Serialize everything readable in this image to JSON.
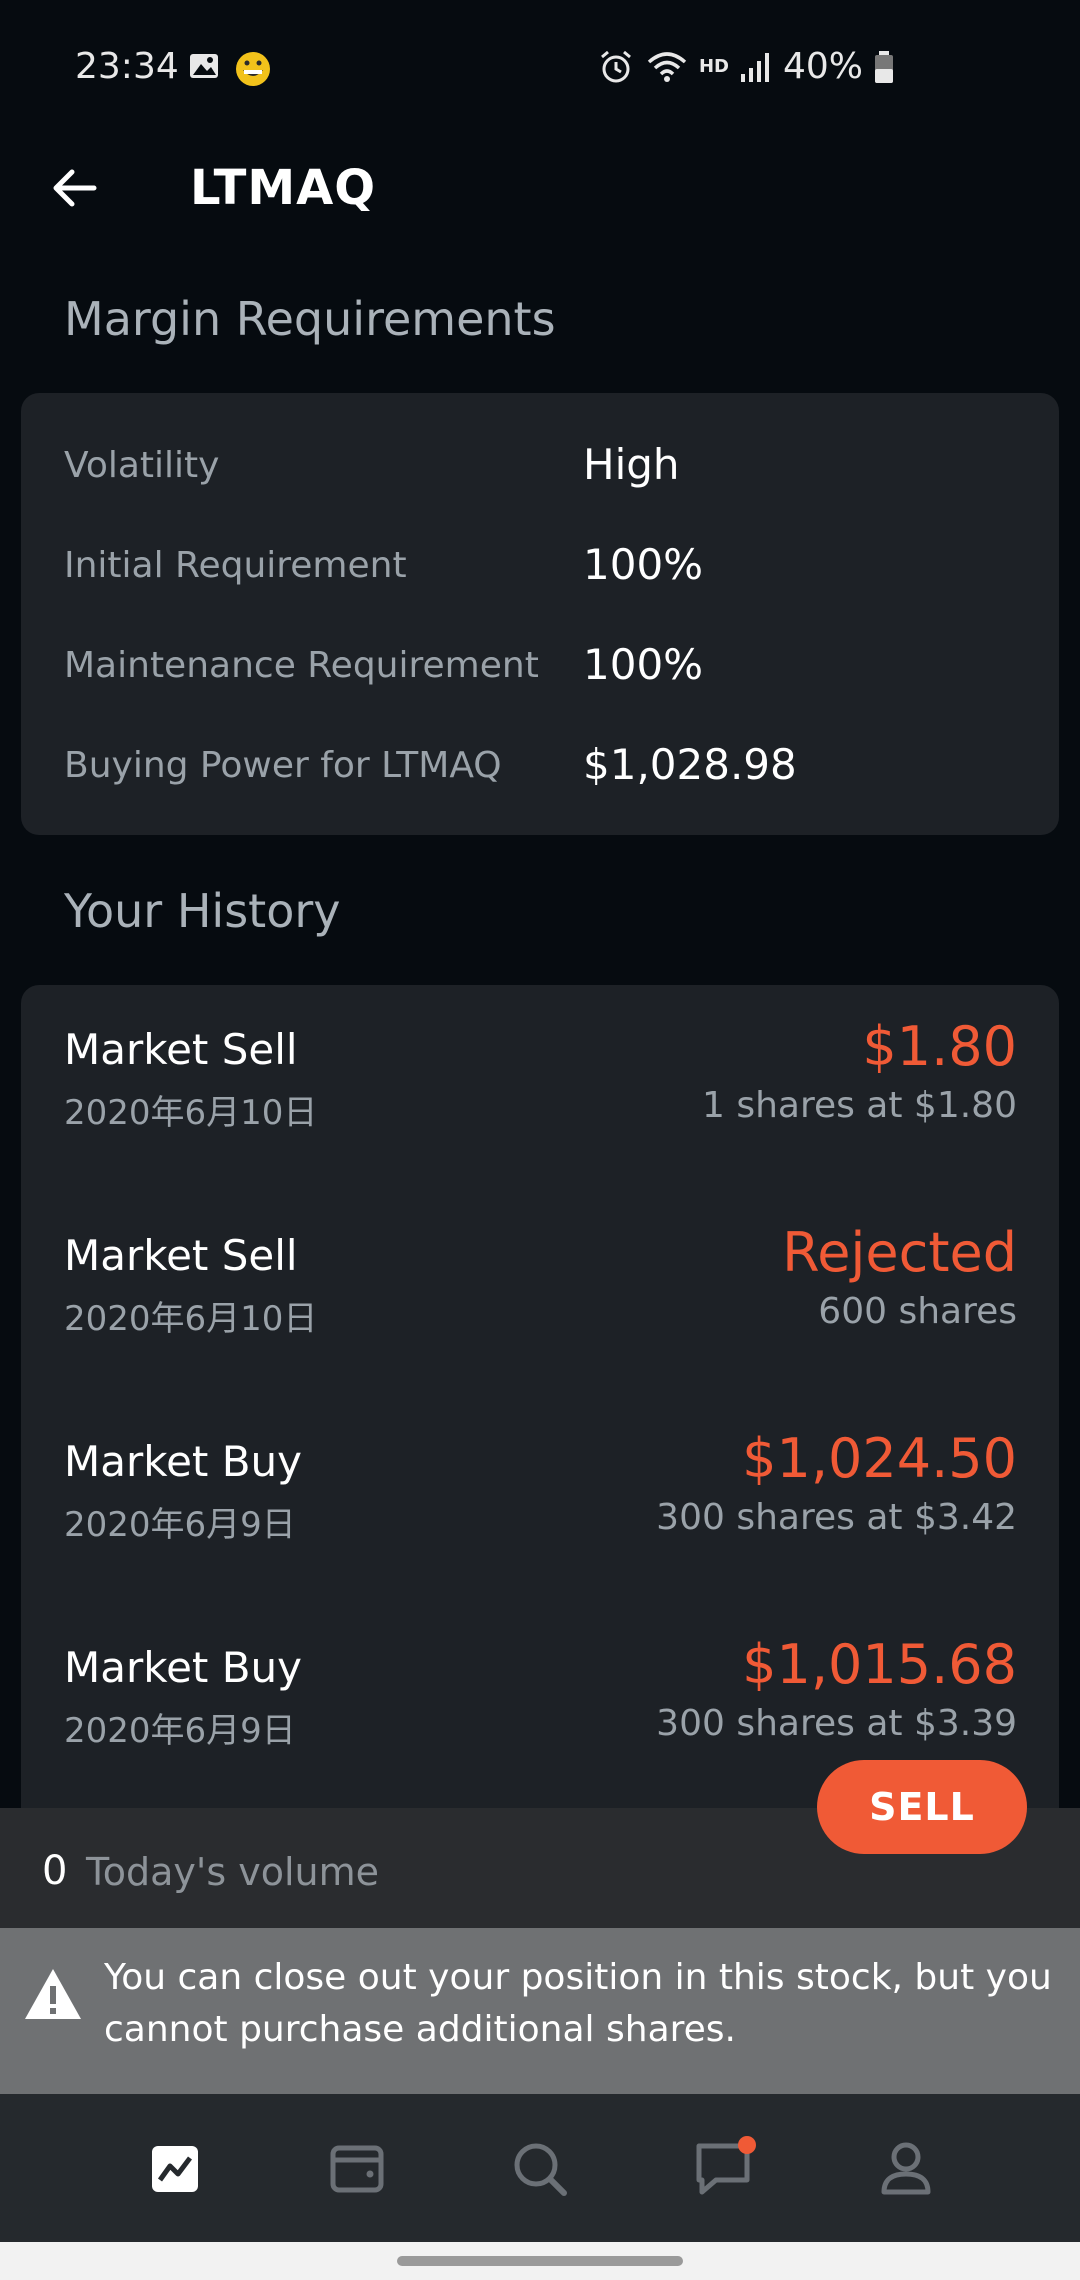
{
  "status_bar": {
    "time": "23:34",
    "network": "HD",
    "battery": "40%",
    "icons": [
      "gallery-icon",
      "emoji-app-icon",
      "alarm-icon",
      "wifi-icon",
      "signal-icon",
      "battery-icon"
    ]
  },
  "header": {
    "title": "LTMAQ",
    "back_icon": "arrow-left-icon"
  },
  "margin": {
    "section_title": "Margin Requirements",
    "rows": [
      {
        "label": "Volatility",
        "value": "High"
      },
      {
        "label": "Initial Requirement",
        "value": "100%"
      },
      {
        "label": "Maintenance Requirement",
        "value": "100%"
      },
      {
        "label": "Buying Power for LTMAQ",
        "value": "$1,028.98"
      }
    ]
  },
  "history": {
    "section_title": "Your History",
    "items": [
      {
        "type": "Market Sell",
        "date": "2020年6月10日",
        "amount": "$1.80",
        "detail": "1 shares at $1.80"
      },
      {
        "type": "Market Sell",
        "date": "2020年6月10日",
        "amount": "Rejected",
        "detail": "600 shares"
      },
      {
        "type": "Market Buy",
        "date": "2020年6月9日",
        "amount": "$1,024.50",
        "detail": "300 shares at $3.42"
      },
      {
        "type": "Market Buy",
        "date": "2020年6月9日",
        "amount": "$1,015.68",
        "detail": "300 shares at $3.39"
      }
    ]
  },
  "volume": {
    "value": "0",
    "label": "Today's volume"
  },
  "sell_button": {
    "label": "SELL"
  },
  "notice": {
    "icon": "warning-icon",
    "text": "You can close out your position in this stock, but you cannot purchase additional shares."
  },
  "bottom_nav": {
    "items": [
      "chart-icon",
      "wallet-icon",
      "search-icon",
      "messages-icon",
      "profile-icon"
    ],
    "active": "chart-icon",
    "badge_on": "messages-icon"
  },
  "colors": {
    "background": "#060b10",
    "card": "#1d2126",
    "accent": "#f05a36",
    "muted_text": "#9aa2a9"
  }
}
